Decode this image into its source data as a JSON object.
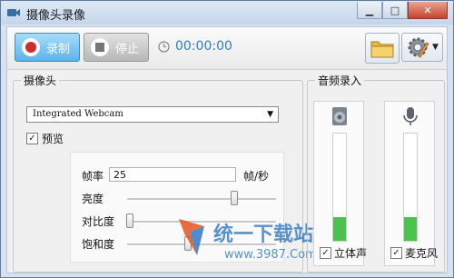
{
  "window": {
    "title": "摄像头录像"
  },
  "toolbar": {
    "record_label": "录制",
    "stop_label": "停止",
    "timer": "00:00:00"
  },
  "camera": {
    "group_label": "摄像头",
    "device": "Integrated Webcam",
    "preview_label": "预览",
    "preview_checked": true,
    "fps_label": "帧率",
    "fps_value": "25",
    "fps_unit": "帧/秒",
    "brightness_label": "亮度",
    "brightness_level": 0.72,
    "contrast_label": "对比度",
    "contrast_level": 0.02,
    "saturation_label": "饱和度",
    "saturation_level": 0.41
  },
  "audio": {
    "group_label": "音频录入",
    "stereo_label": "立体声",
    "stereo_checked": true,
    "stereo_level": 0.22,
    "mic_label": "麦克风",
    "mic_checked": true,
    "mic_level": 0.22
  },
  "watermark": {
    "text": "统一下载站",
    "url": "www.3987.Com"
  },
  "colors": {
    "accent": "#5cb4ea",
    "timer": "#2c7fc6",
    "meter": "#4bc24b"
  },
  "icons": [
    "record-icon",
    "stop-icon",
    "clock-icon",
    "folder-icon",
    "gear-icon",
    "speaker-icon",
    "microphone-icon"
  ]
}
